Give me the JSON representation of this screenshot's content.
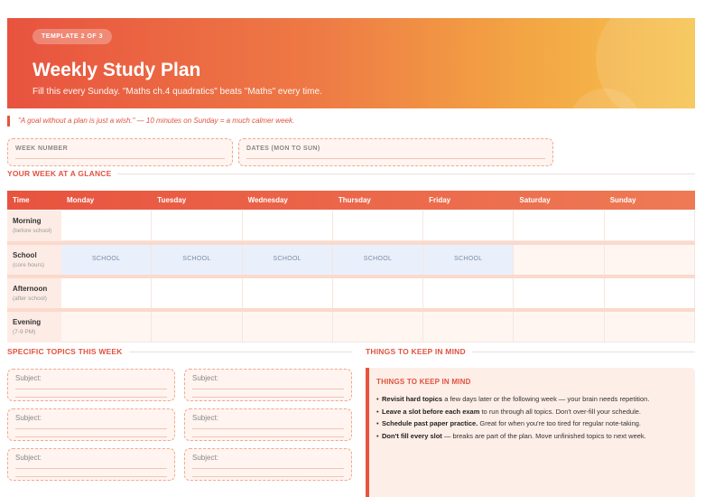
{
  "header": {
    "badge": "TEMPLATE 2 OF 3",
    "title": "Weekly Study Plan",
    "subtitle": "Fill this every Sunday. \"Maths ch.4 quadratics\" beats \"Maths\" every time."
  },
  "quote": "\"A goal without a plan is just a wish.\" — 10 minutes on Sunday = a much calmer week.",
  "fields": {
    "week_number": "WEEK NUMBER",
    "dates": "DATES (MON TO SUN)"
  },
  "sections": {
    "glance": "YOUR WEEK AT A GLANCE",
    "topics": "SPECIFIC TOPICS THIS WEEK",
    "keep_in_mind": "THINGS TO KEEP IN MIND"
  },
  "table": {
    "time_header": "Time",
    "days": [
      "Monday",
      "Tuesday",
      "Wednesday",
      "Thursday",
      "Friday",
      "Saturday",
      "Sunday"
    ],
    "rows": [
      {
        "label": "Morning",
        "sub": "(before school)"
      },
      {
        "label": "School",
        "sub": "(core hours)"
      },
      {
        "label": "Afternoon",
        "sub": "(after school)"
      },
      {
        "label": "Evening",
        "sub": "(7-9 PM)"
      }
    ],
    "school_label": "SCHOOL"
  },
  "subjects": {
    "label": "Subject:"
  },
  "keep_in_mind": {
    "heading": "THINGS TO KEEP IN MIND",
    "items": [
      {
        "bold": "Revisit hard topics",
        "text": " a few days later or the following week — your brain needs repetition."
      },
      {
        "bold": "Leave a slot before each exam",
        "text": " to run through all topics. Don't over-fill your schedule."
      },
      {
        "bold": "Schedule past paper practice.",
        "text": " Great for when you're too tired for regular note-taking."
      },
      {
        "bold": "Don't fill every slot",
        "text": " — breaks are part of the plan. Move unfinished topics to next week."
      }
    ]
  },
  "colors": {
    "accent": "#e8533f",
    "accent_light": "#fdeee7",
    "school_fill": "#e9f0fb"
  }
}
